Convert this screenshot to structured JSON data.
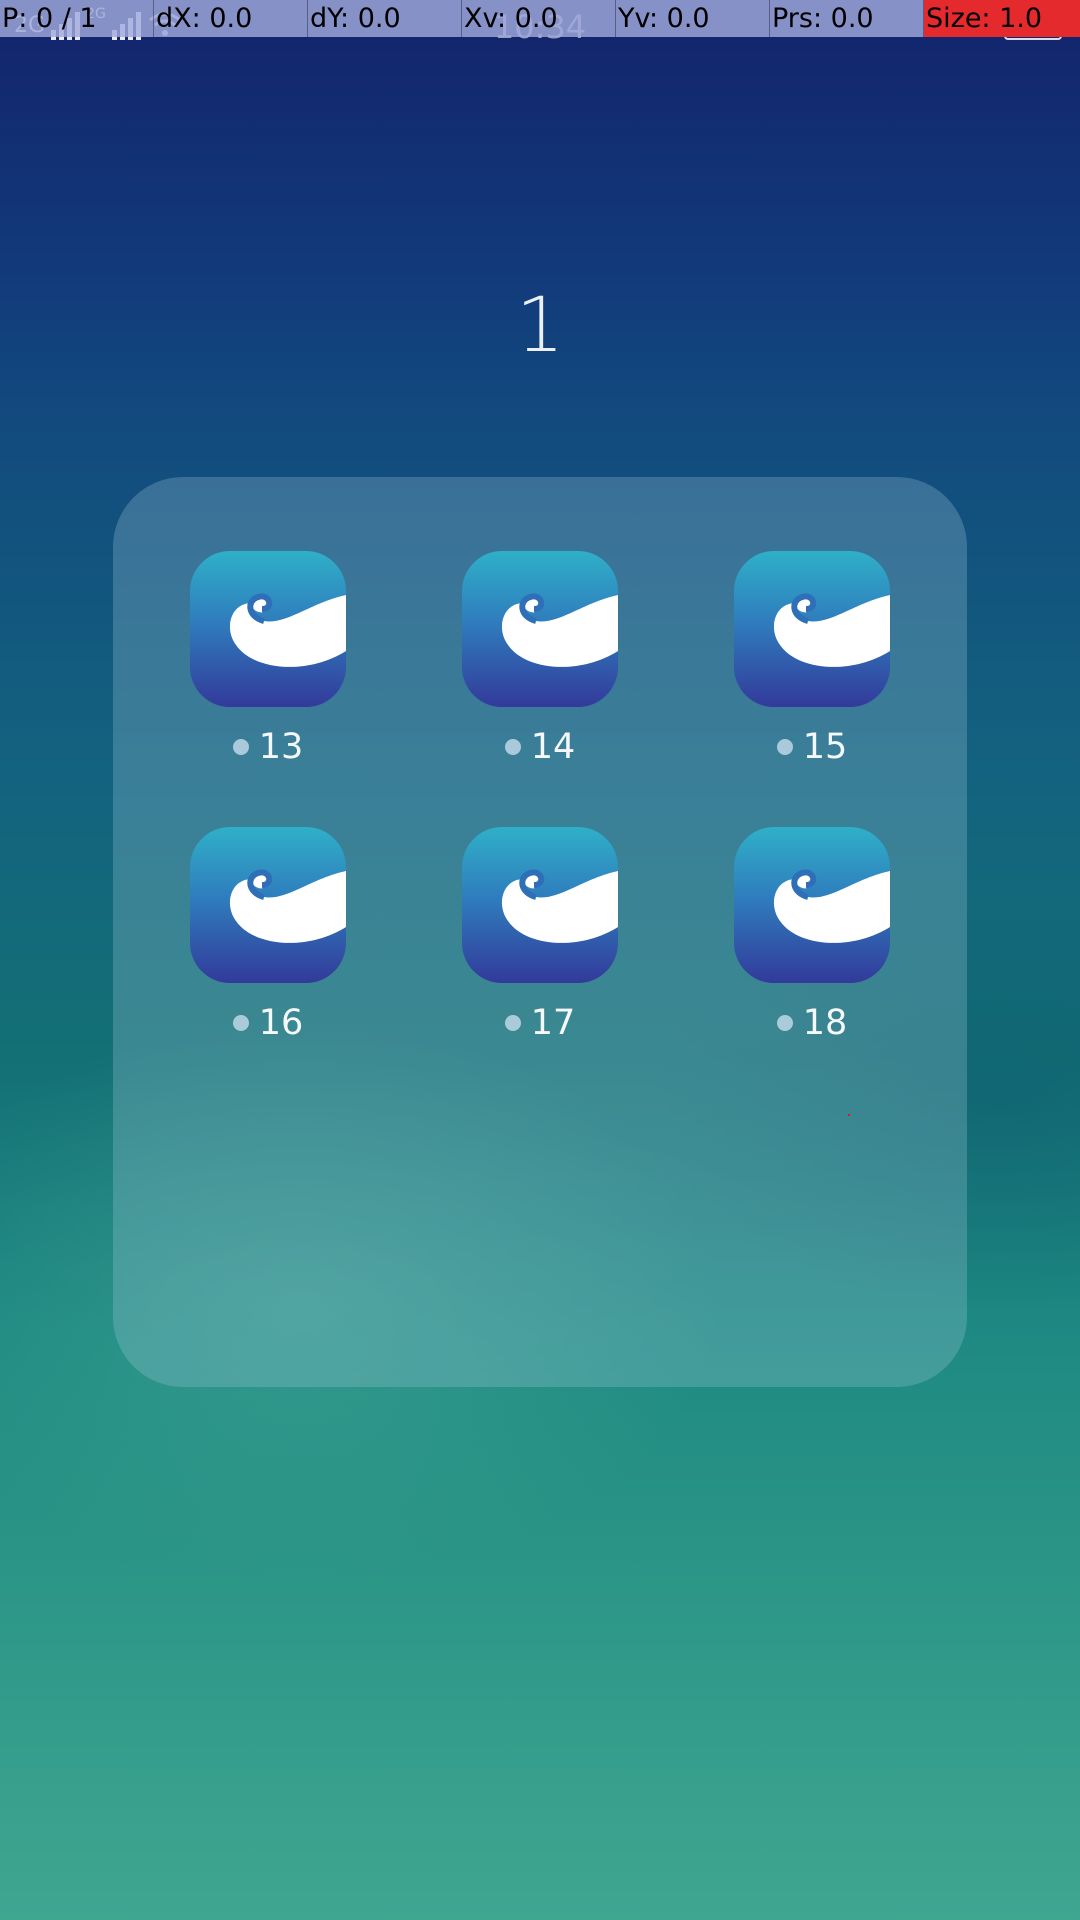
{
  "pointer_overlay": {
    "cells": [
      "P: 0 / 1",
      "dX: 0.0",
      "dY: 0.0",
      "Xv: 0.0",
      "Yv: 0.0",
      "Prs: 0.0",
      "Size: 1.0"
    ]
  },
  "status_bar": {
    "time": "10:34",
    "network_type": "2G",
    "carrier_tag": "2G"
  },
  "folder": {
    "title": "1",
    "apps": [
      {
        "label": "13",
        "icon": "whale-app-icon"
      },
      {
        "label": "14",
        "icon": "whale-app-icon"
      },
      {
        "label": "15",
        "icon": "whale-app-icon"
      },
      {
        "label": "16",
        "icon": "whale-app-icon"
      },
      {
        "label": "17",
        "icon": "whale-app-icon"
      },
      {
        "label": "18",
        "icon": "whale-app-icon"
      }
    ]
  },
  "colors": {
    "overlay_cell": "#a0aadc",
    "overlay_alert": "#e52a2e",
    "icon_top": "#2fb0c8",
    "icon_bottom": "#323a9a"
  }
}
